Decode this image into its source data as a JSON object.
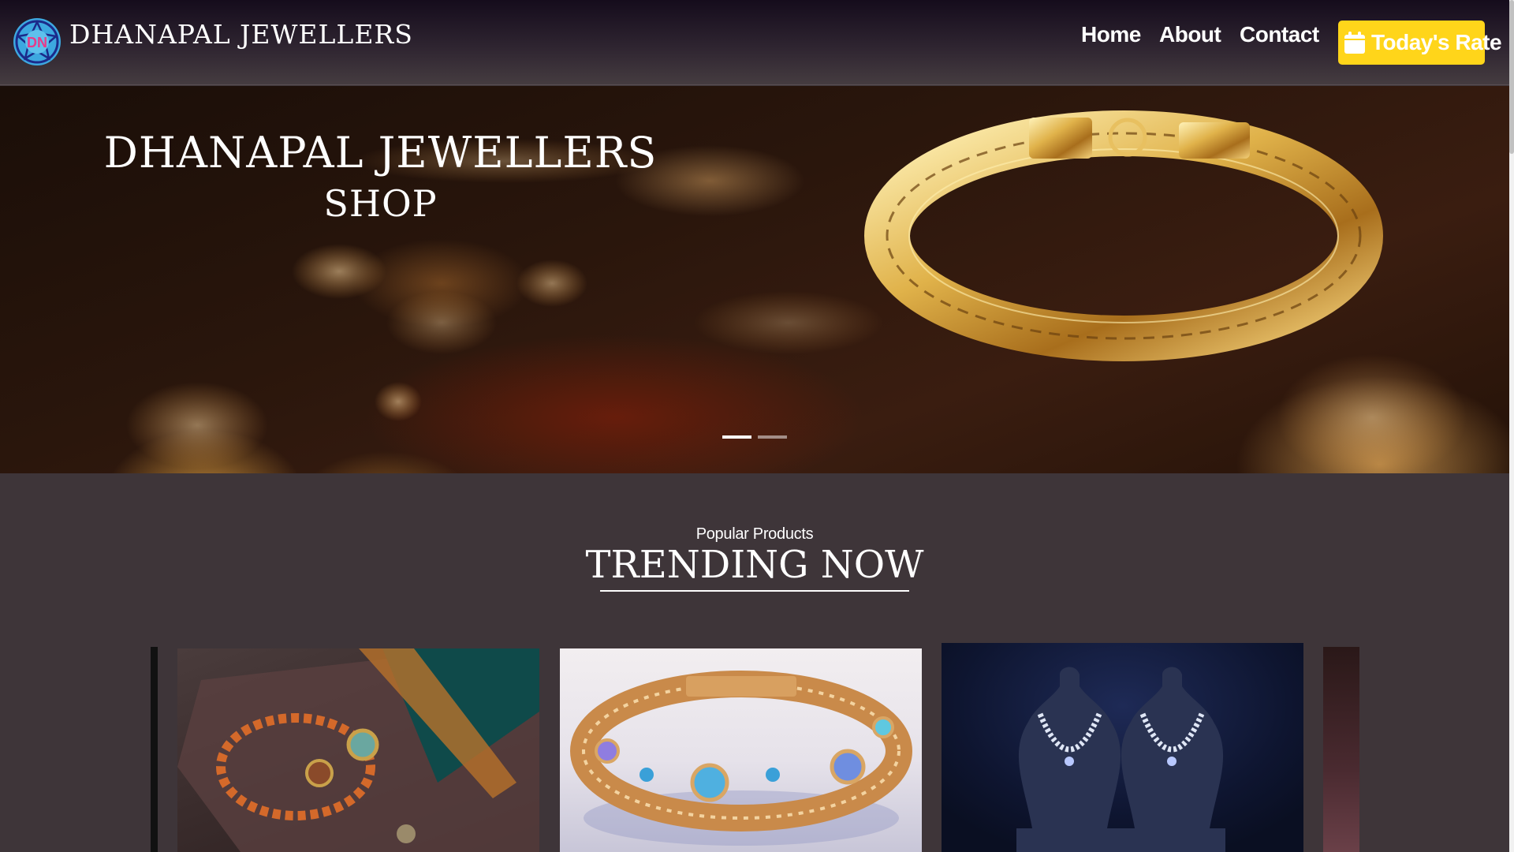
{
  "header": {
    "brand": "DHANAPAL JEWELLERS",
    "logo_text": "DN",
    "logo_icon": "mandala-logo-icon",
    "nav": [
      {
        "label": "Home"
      },
      {
        "label": "About"
      },
      {
        "label": "Contact"
      }
    ],
    "rate_button": {
      "label": "Today's Rate",
      "icon": "calendar-icon"
    }
  },
  "hero": {
    "title": "DHANAPAL JEWELLERS",
    "subtitle": "SHOP",
    "slides": 2,
    "active_slide": 1
  },
  "trending": {
    "kicker": "Popular Products",
    "title": "TRENDING NOW",
    "products": [
      {
        "image": "rudraksha-bracelet-in-box"
      },
      {
        "image": "gemstone-gold-bracelet"
      },
      {
        "image": "diamond-necklaces-on-busts"
      }
    ]
  },
  "colors": {
    "accent": "#ffd51a",
    "background": "#3e3539",
    "text": "#ffffff"
  }
}
